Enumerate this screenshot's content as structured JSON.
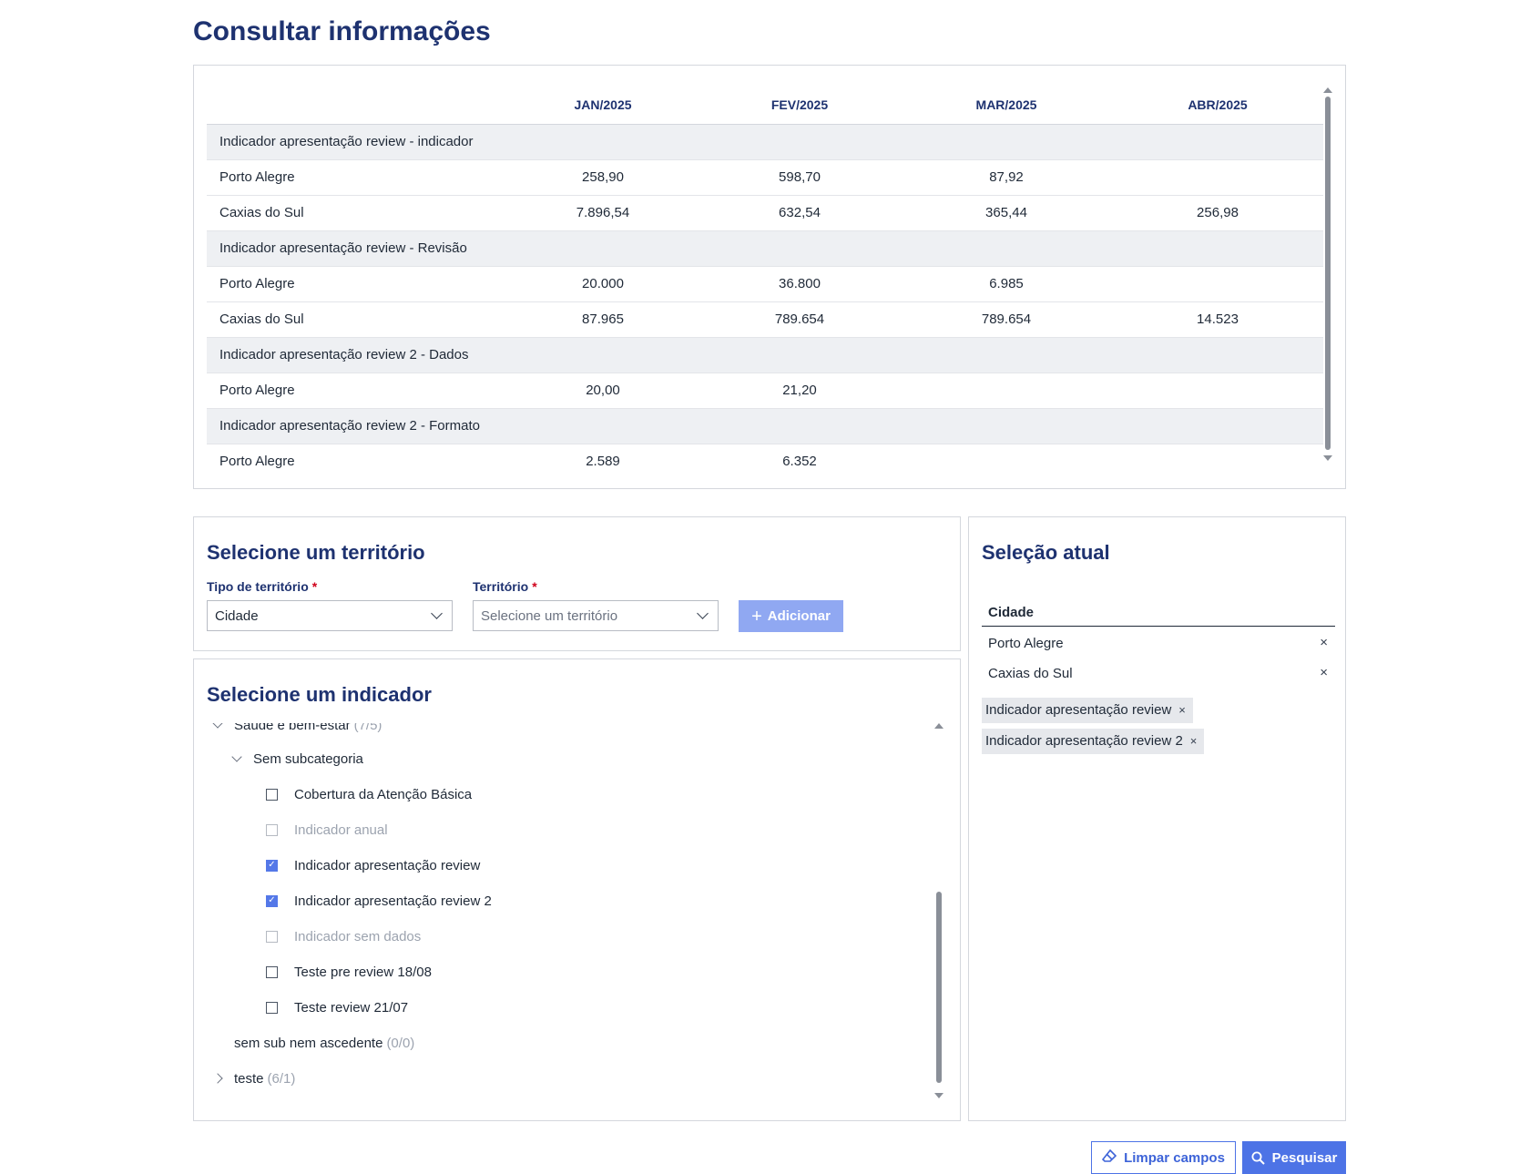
{
  "page": {
    "title": "Consultar informações"
  },
  "table": {
    "columns": [
      "",
      "JAN/2025",
      "FEV/2025",
      "MAR/2025",
      "ABR/2025"
    ],
    "rows": [
      {
        "type": "group",
        "label": "Indicador apresentação review - indicador"
      },
      {
        "type": "data",
        "name": "Porto Alegre",
        "values": [
          "258,90",
          "598,70",
          "87,92",
          ""
        ]
      },
      {
        "type": "data",
        "name": "Caxias do Sul",
        "values": [
          "7.896,54",
          "632,54",
          "365,44",
          "256,98"
        ]
      },
      {
        "type": "group",
        "label": "Indicador apresentação review - Revisão"
      },
      {
        "type": "data",
        "name": "Porto Alegre",
        "values": [
          "20.000",
          "36.800",
          "6.985",
          ""
        ]
      },
      {
        "type": "data",
        "name": "Caxias do Sul",
        "values": [
          "87.965",
          "789.654",
          "789.654",
          "14.523"
        ]
      },
      {
        "type": "group",
        "label": "Indicador apresentação review 2 - Dados"
      },
      {
        "type": "data",
        "name": "Porto Alegre",
        "values": [
          "20,00",
          "21,20",
          "",
          ""
        ]
      },
      {
        "type": "group",
        "label": "Indicador apresentação review 2 - Formato"
      },
      {
        "type": "data",
        "name": "Porto Alegre",
        "values": [
          "2.589",
          "6.352",
          "",
          ""
        ]
      }
    ]
  },
  "territory": {
    "title": "Selecione um território",
    "type_label": "Tipo de território",
    "type_value": "Cidade",
    "territory_label": "Território",
    "territory_placeholder": "Selecione um território",
    "required_mark": "*",
    "add_button": "Adicionar"
  },
  "indicator": {
    "title": "Selecione um indicador",
    "category": {
      "label": "Saúde e bem-estar",
      "count": "(7/5)"
    },
    "subcategory": "Sem subcategoria",
    "items": [
      {
        "label": "Cobertura da Atenção Básica",
        "checked": false,
        "disabled": false
      },
      {
        "label": "Indicador anual",
        "checked": false,
        "disabled": true
      },
      {
        "label": "Indicador apresentação review",
        "checked": true,
        "disabled": false
      },
      {
        "label": "Indicador apresentação review 2",
        "checked": true,
        "disabled": false
      },
      {
        "label": "Indicador sem dados",
        "checked": false,
        "disabled": true
      },
      {
        "label": "Teste pre review 18/08",
        "checked": false,
        "disabled": false
      },
      {
        "label": "Teste review 21/07",
        "checked": false,
        "disabled": false
      }
    ],
    "other_subcategory": {
      "label": "sem sub nem ascedente",
      "count": "(0/0)"
    },
    "other_category": {
      "label": "teste",
      "count": "(6/1)"
    }
  },
  "selection": {
    "title": "Seleção atual",
    "header": "Cidade",
    "cities": [
      "Porto Alegre",
      "Caxias do Sul"
    ],
    "indicators": [
      "Indicador apresentação review",
      "Indicador apresentação review 2"
    ],
    "remove_symbol": "×"
  },
  "actions": {
    "clear_label": "Limpar campos",
    "search_label": "Pesquisar"
  },
  "colors": {
    "title": "#1e3270",
    "primary": "#4d73e6",
    "primary_disabled": "#90a8f2",
    "required": "#d0021b"
  },
  "icons": [
    "chevron-down-icon",
    "plus-icon",
    "close-icon",
    "checkbox-icon",
    "eraser-icon",
    "search-icon"
  ]
}
